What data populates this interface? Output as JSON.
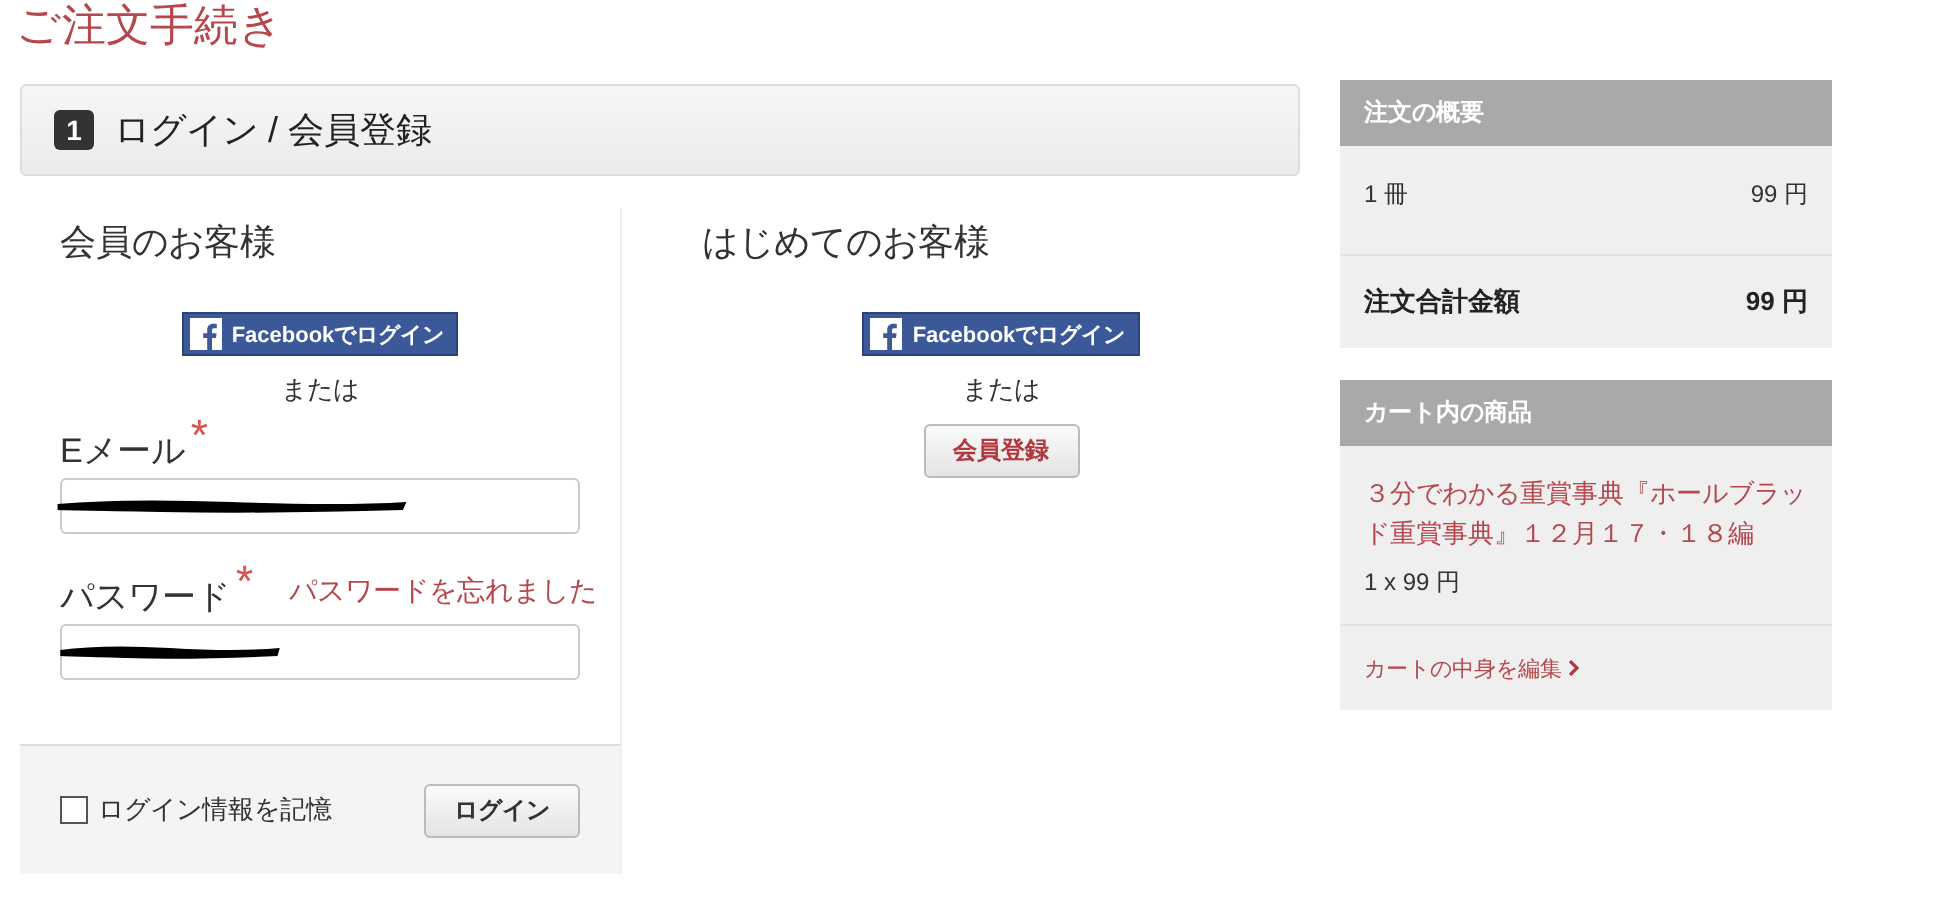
{
  "page_title": "ご注文手続き",
  "step": {
    "number": "1",
    "title": "ログイン / 会員登録"
  },
  "member": {
    "heading": "会員のお客様",
    "facebook_button": "Facebookでログイン",
    "or_text": "または",
    "fields": [
      {
        "label": "Eメール",
        "required_mark": "*",
        "redacted": true
      },
      {
        "label": "パスワード",
        "required_mark": "*",
        "redacted": true,
        "link": "パスワードを忘れました"
      }
    ],
    "remember": {
      "label": "ログイン情報を記憶",
      "checked": false
    },
    "login_button": "ログイン"
  },
  "guest": {
    "heading": "はじめてのお客様",
    "facebook_button": "Facebookでログイン",
    "or_text": "または",
    "register_button": "会員登録"
  },
  "summary": {
    "title": "注文の概要",
    "rows": [
      {
        "label": "1 冊",
        "value": "99 円",
        "kind": "line"
      },
      {
        "label": "注文合計金額",
        "value": "99 円",
        "kind": "total"
      }
    ]
  },
  "cart": {
    "title": "カート内の商品",
    "items": [
      {
        "name": "３分でわかる重賞事典『ホールブラッド重賞事典』１２月１７・１８編",
        "price": "1 x 99 円"
      }
    ],
    "edit_link": "カートの中身を編集"
  }
}
